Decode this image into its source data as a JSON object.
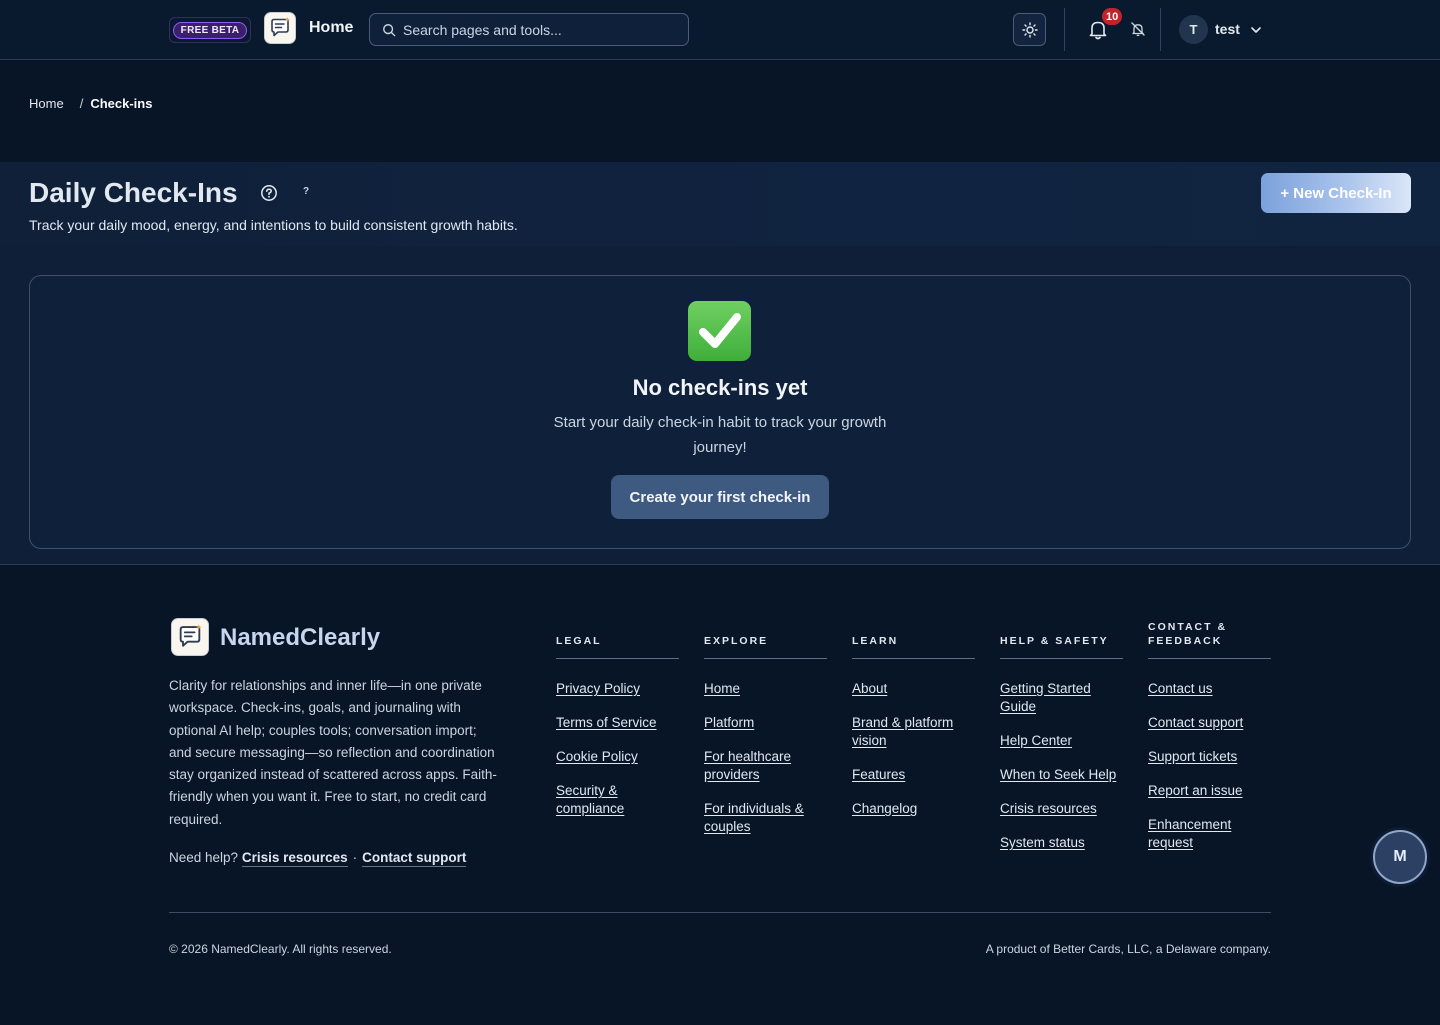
{
  "header": {
    "beta_label": "FREE BETA",
    "title": "Home",
    "search_placeholder": "Search pages and tools...",
    "notification_count": "10",
    "user_initial": "T",
    "username": "test"
  },
  "breadcrumb": {
    "home": "Home",
    "separator": "/",
    "current": "Check-ins"
  },
  "page": {
    "title": "Daily Check-Ins",
    "help_hint": "?",
    "subtitle": "Track your daily mood, energy, and intentions to build consistent growth habits.",
    "new_button": "+ New Check-In"
  },
  "empty_state": {
    "title": "No check-ins yet",
    "description": "Start your daily check-in habit to track your growth journey!",
    "button": "Create your first check-in"
  },
  "footer": {
    "brand": "NamedClearly",
    "blurb": "Clarity for relationships and inner life—in one private workspace. Check-ins, goals, and journaling with optional AI help; couples tools; conversation import; and secure messaging—so reflection and coordination stay organized instead of scattered across apps. Faith-friendly when you want it. Free to start, no credit card required.",
    "need_help": "Need help?",
    "crisis_link": "Crisis resources",
    "dot": "·",
    "support_link": "Contact support",
    "columns": [
      {
        "heading": "LEGAL",
        "links": [
          "Privacy Policy",
          "Terms of Service",
          "Cookie Policy",
          "Security & compliance"
        ]
      },
      {
        "heading": "EXPLORE",
        "links": [
          "Home",
          "Platform",
          "For healthcare providers",
          "For individuals & couples"
        ]
      },
      {
        "heading": "LEARN",
        "links": [
          "About",
          "Brand & platform vision",
          "Features",
          "Changelog"
        ]
      },
      {
        "heading": "HELP & SAFETY",
        "links": [
          "Getting Started Guide",
          "Help Center",
          "When to Seek Help",
          "Crisis resources",
          "System status"
        ]
      },
      {
        "heading": "CONTACT & FEEDBACK",
        "links": [
          "Contact us",
          "Contact support",
          "Support tickets",
          "Report an issue",
          "Enhancement request"
        ]
      }
    ],
    "copyright": "© 2026 NamedClearly. All rights reserved.",
    "product_note": "A product of Better Cards, LLC, a Delaware company."
  },
  "chat_fab": "M",
  "icons": {
    "search": "search-icon",
    "theme": "sun-icon",
    "notifications": "bell-icon",
    "mute": "bell-off-icon",
    "menu": "chevron-down-icon",
    "help": "help-circle-icon",
    "empty": "check-mark-icon",
    "logo": "chat-bubble-logo-icon"
  },
  "colors": {
    "background": "#081526",
    "accent": "#7ba1dc",
    "badge": "#c0242b",
    "beta": "#8b5cf6"
  }
}
